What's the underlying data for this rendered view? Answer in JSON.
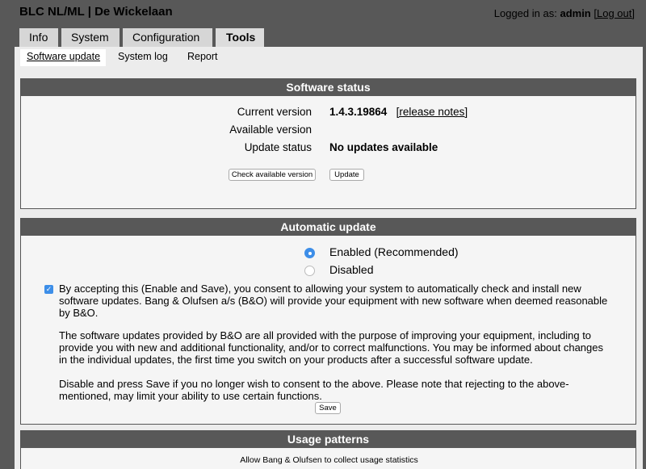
{
  "header": {
    "title": "BLC NL/ML | De Wickelaan",
    "logged_in_prefix": "Logged in as:",
    "user": "admin",
    "logout_label": "[Log out]"
  },
  "tabs": [
    {
      "label": "Info",
      "active": false
    },
    {
      "label": "System",
      "active": false
    },
    {
      "label": "Configuration",
      "active": false
    },
    {
      "label": "Tools",
      "active": true
    }
  ],
  "subtabs": [
    {
      "label": "Software update",
      "active": true
    },
    {
      "label": "System log",
      "active": false
    },
    {
      "label": "Report",
      "active": false
    }
  ],
  "software_status": {
    "title": "Software status",
    "current_version_label": "Current version",
    "current_version_value": "1.4.3.19864",
    "release_notes_label": "[release notes]",
    "available_version_label": "Available version",
    "available_version_value": "",
    "update_status_label": "Update status",
    "update_status_value": "No updates available",
    "check_button": "Check available version",
    "update_button": "Update"
  },
  "automatic_update": {
    "title": "Automatic update",
    "enabled_label": "Enabled (Recommended)",
    "disabled_label": "Disabled",
    "selected": "enabled",
    "consent_checked": true,
    "para1": "By accepting this (Enable and Save), you consent to allowing your system to automatically check and install new software updates. Bang & Olufsen a/s (B&O) will provide your equipment with new software when deemed reasonable by B&O.",
    "para2": "The software updates provided by B&O are all provided with the purpose of improving your equipment, including to provide you with new and additional functionality, and/or to correct malfunctions. You may be informed about changes in the individual updates, the first time you switch on your products after a successful software update.",
    "para3": "Disable and press Save if you no longer wish to consent to the above. Please note that rejecting to the above-mentioned, may limit your ability to use certain functions.",
    "save_button": "Save"
  },
  "usage_patterns": {
    "title": "Usage patterns",
    "allow_text": "Allow Bang & Olufsen to collect usage statistics"
  },
  "colors": {
    "accent": "#3d8ee8",
    "header_bg": "#585858",
    "content_bg": "#ececec"
  }
}
